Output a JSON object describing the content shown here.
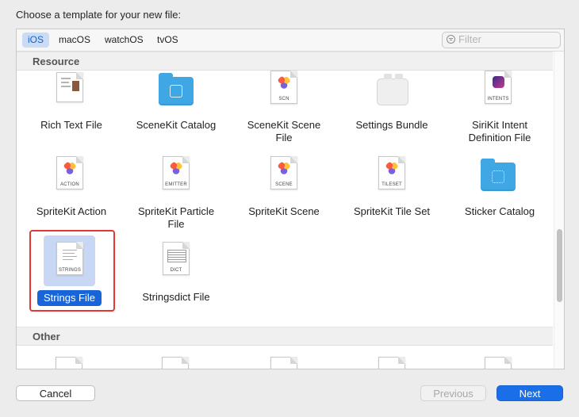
{
  "dialog": {
    "prompt": "Choose a template for your new file:"
  },
  "platform_tabs": [
    {
      "label": "iOS",
      "selected": true
    },
    {
      "label": "macOS",
      "selected": false
    },
    {
      "label": "watchOS",
      "selected": false
    },
    {
      "label": "tvOS",
      "selected": false
    }
  ],
  "filter": {
    "placeholder": "Filter",
    "value": ""
  },
  "sections": {
    "resource": "Resource",
    "other": "Other"
  },
  "templates": {
    "rich_text": {
      "label": "Rich Text File"
    },
    "scenekit_catalog": {
      "label": "SceneKit Catalog"
    },
    "scenekit_scene": {
      "label": "SceneKit Scene\nFile",
      "line1": "SceneKit Scene",
      "line2": "File",
      "tag": "SCN"
    },
    "settings_bundle": {
      "label": "Settings Bundle"
    },
    "sirikit_intent": {
      "line1": "SiriKit Intent",
      "line2": "Definition File",
      "tag": "INTENTS"
    },
    "spritekit_action": {
      "label": "SpriteKit Action",
      "tag": "ACTION"
    },
    "spritekit_particle": {
      "line1": "SpriteKit Particle",
      "line2": "File",
      "tag": "EMITTER"
    },
    "spritekit_scene": {
      "label": "SpriteKit Scene",
      "tag": "SCENE"
    },
    "spritekit_tileset": {
      "label": "SpriteKit Tile Set",
      "tag": "TILESET"
    },
    "sticker_catalog": {
      "label": "Sticker Catalog"
    },
    "strings": {
      "label": "Strings File",
      "tag": "STRINGS",
      "selected": true
    },
    "stringsdict": {
      "label": "Stringsdict File",
      "tag": "DICT"
    }
  },
  "buttons": {
    "cancel": "Cancel",
    "previous": "Previous",
    "next": "Next",
    "previous_enabled": false
  },
  "colors": {
    "accent": "#1a6fe8",
    "selection": "#1864d9",
    "highlight_box": "#e53632"
  }
}
